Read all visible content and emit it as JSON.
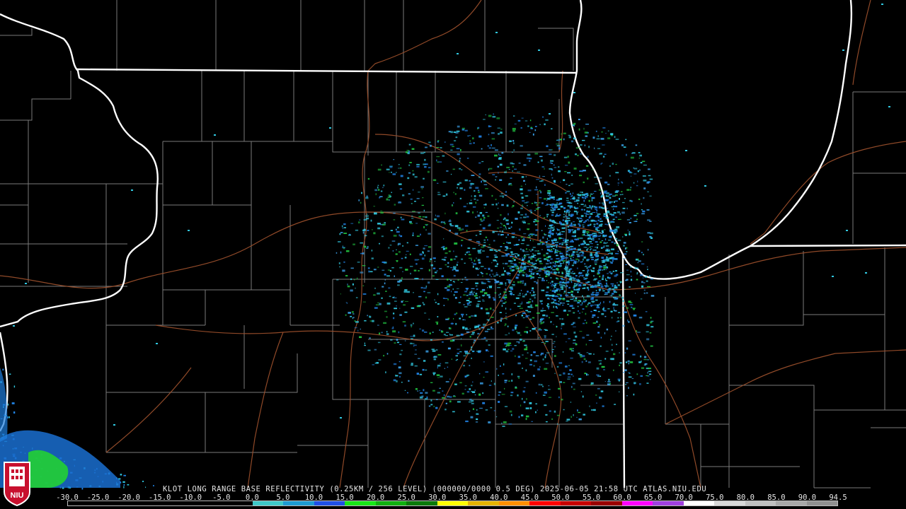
{
  "title": "KLOT LONG RANGE BASE REFLECTIVITY (0.25KM / 256 LEVEL) (000000/0000 0.5 DEG) 2025-06-05 21:58 UTC  ATLAS.NIU.EDU",
  "logo_text": "NIU",
  "scale": {
    "labels": [
      "-30.0",
      "-25.0",
      "-20.0",
      "-15.0",
      "-10.0",
      "-5.0",
      "0.0",
      "5.0",
      "10.0",
      "15.0",
      "20.0",
      "25.0",
      "30.0",
      "35.0",
      "40.0",
      "45.0",
      "50.0",
      "55.0",
      "60.0",
      "65.0",
      "70.0",
      "75.0",
      "80.0",
      "85.0",
      "90.0",
      "94.5"
    ],
    "colors": [
      "#000000",
      "#000000",
      "#000000",
      "#000000",
      "#000000",
      "#000000",
      "#3fc8c8",
      "#1e9bd2",
      "#2050e6",
      "#18e818",
      "#10b010",
      "#0a7a0a",
      "#ffff00",
      "#e6b400",
      "#ff9000",
      "#ff0000",
      "#c80000",
      "#9a0000",
      "#ff00ff",
      "#a040e0",
      "#ffffff",
      "#d8d8d8",
      "#c0c0c0",
      "#a8a8a8",
      "#909090"
    ]
  },
  "map_colors": {
    "background": "#000000",
    "state_borders": "#ffffff",
    "county_lines": "#808080",
    "highways": "#a0522d",
    "echo_cyan": "#30c8e0",
    "echo_blue": "#2080e0",
    "echo_green": "#20c040"
  }
}
